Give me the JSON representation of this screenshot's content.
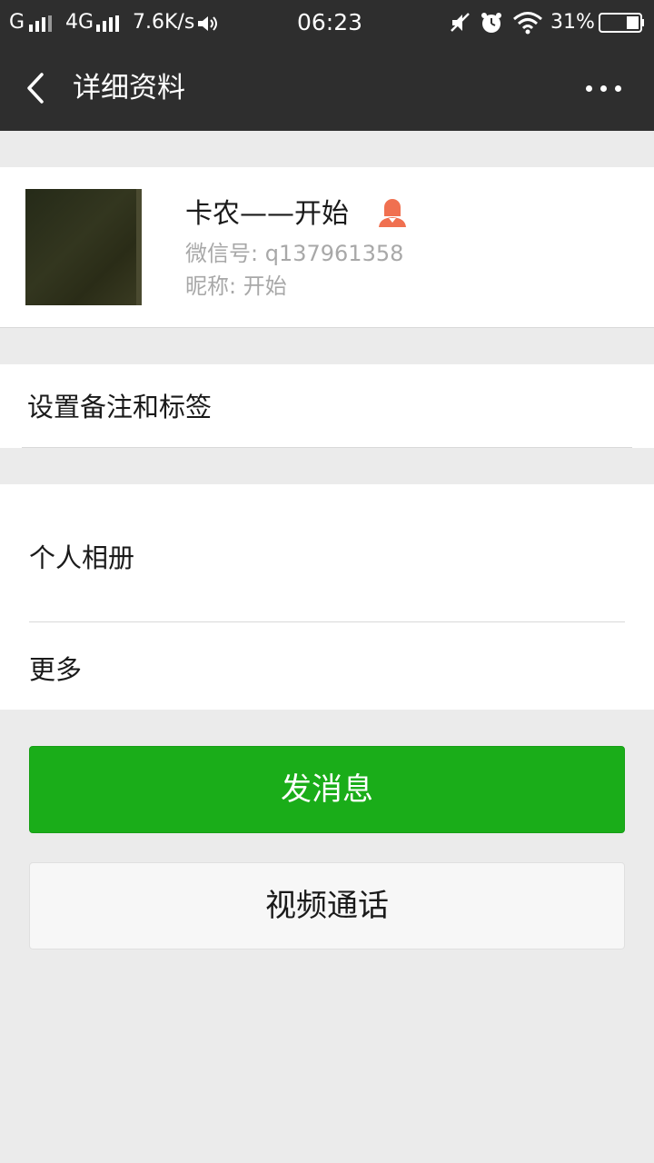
{
  "status_bar": {
    "carrier1": "G",
    "network": "4G",
    "speed": "7.6K/s",
    "time": "06:23",
    "battery": "31%",
    "icons": [
      "signal-icon",
      "signal-icon",
      "speaker-icon",
      "mute-icon",
      "alarm-icon",
      "wifi-icon",
      "battery-icon"
    ]
  },
  "nav": {
    "title": "详细资料",
    "back_icon": "chevron-left-icon",
    "more_icon": "more-icon"
  },
  "profile": {
    "name": "卡农——开始",
    "gender_icon": "female-icon",
    "gender_color": "#f07050",
    "wechat_id": "微信号: q137961358",
    "nickname": "昵称: 开始"
  },
  "rows": {
    "remark": "设置备注和标签",
    "album": "个人相册",
    "more": "更多"
  },
  "buttons": {
    "send": "发消息",
    "video": "视频通话"
  },
  "colors": {
    "header": "#2e2e2e",
    "primary_green": "#1aad19",
    "background": "#ebebeb"
  }
}
